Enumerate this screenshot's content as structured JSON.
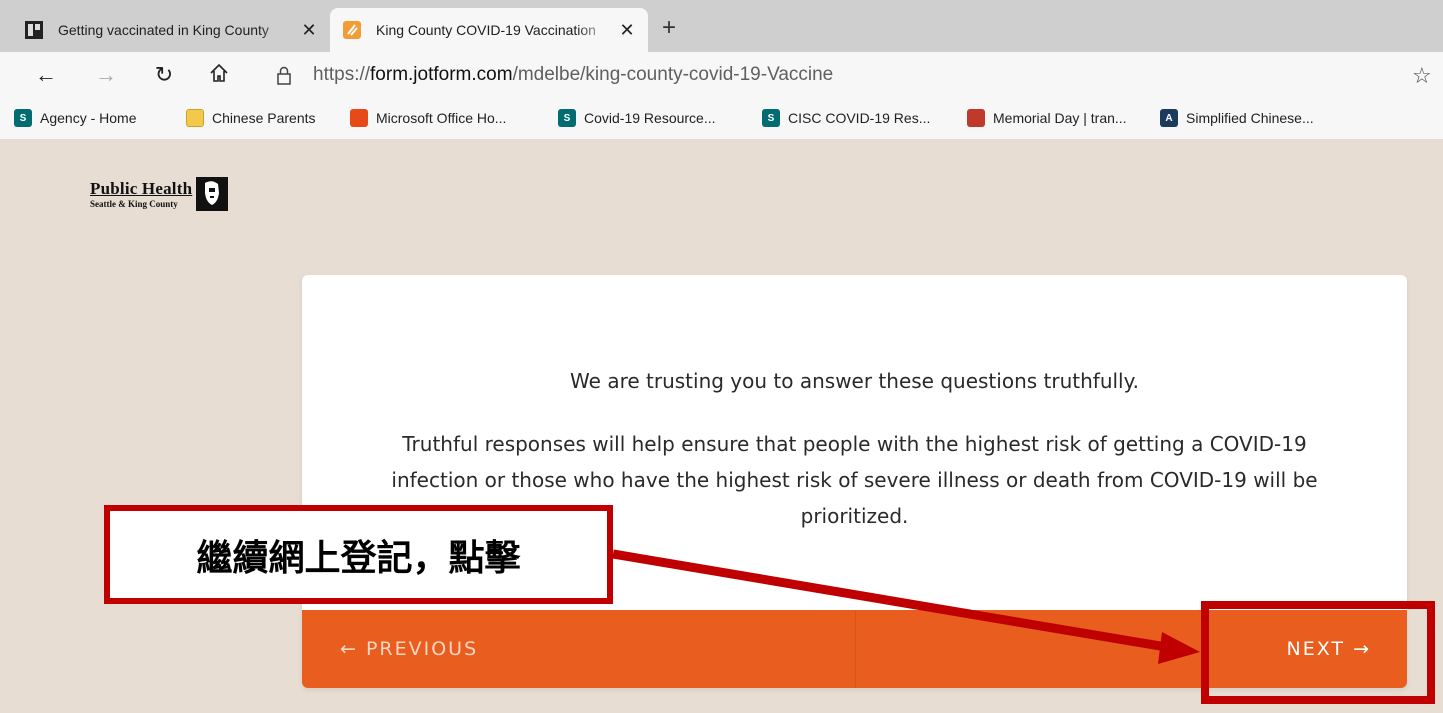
{
  "browser": {
    "tabs": [
      {
        "title": "Getting vaccinated in King County",
        "active": false,
        "icon": "kingcounty-logo-icon"
      },
      {
        "title": "King County COVID-19 Vaccination",
        "active": true,
        "icon": "jotform-icon"
      }
    ],
    "new_tab_glyph": "+",
    "close_glyph": "✕",
    "url_prefix": "https://",
    "url_domain": "form.jotform.com",
    "url_path": "/mdelbe/king-county-covid-19-Vaccine",
    "bookmarks": [
      {
        "label": "Agency - Home",
        "icon": "sharepoint-icon",
        "color": "#036c70"
      },
      {
        "label": "Chinese Parents",
        "icon": "folder-icon",
        "color": "#f2c94c"
      },
      {
        "label": "Microsoft Office Ho...",
        "icon": "office-icon",
        "color": "#e64a19"
      },
      {
        "label": "Covid-19 Resource...",
        "icon": "sharepoint-icon",
        "color": "#036c70"
      },
      {
        "label": "CISC COVID-19 Res...",
        "icon": "sharepoint-icon",
        "color": "#036c70"
      },
      {
        "label": "Memorial Day | tran...",
        "icon": "shield-crest-icon",
        "color": "#c0392b"
      },
      {
        "label": "Simplified Chinese...",
        "icon": "translate-icon",
        "color": "#1b3a5c"
      }
    ]
  },
  "page": {
    "logo_title": "Public Health",
    "logo_subtitle": "Seattle & King County",
    "statement": "We are trusting you to answer these questions truthfully.",
    "detail": "Truthful responses will help ensure that people with the highest risk of getting a COVID-19 infection or those who have the highest risk of severe illness or death from COVID-19 will be prioritized.",
    "previous_label": "← PREVIOUS",
    "next_label": "NEXT →",
    "accent_color": "#e95d1e"
  },
  "annotation": {
    "callout_text": "繼續網上登記，點擊",
    "color": "#c00000"
  }
}
